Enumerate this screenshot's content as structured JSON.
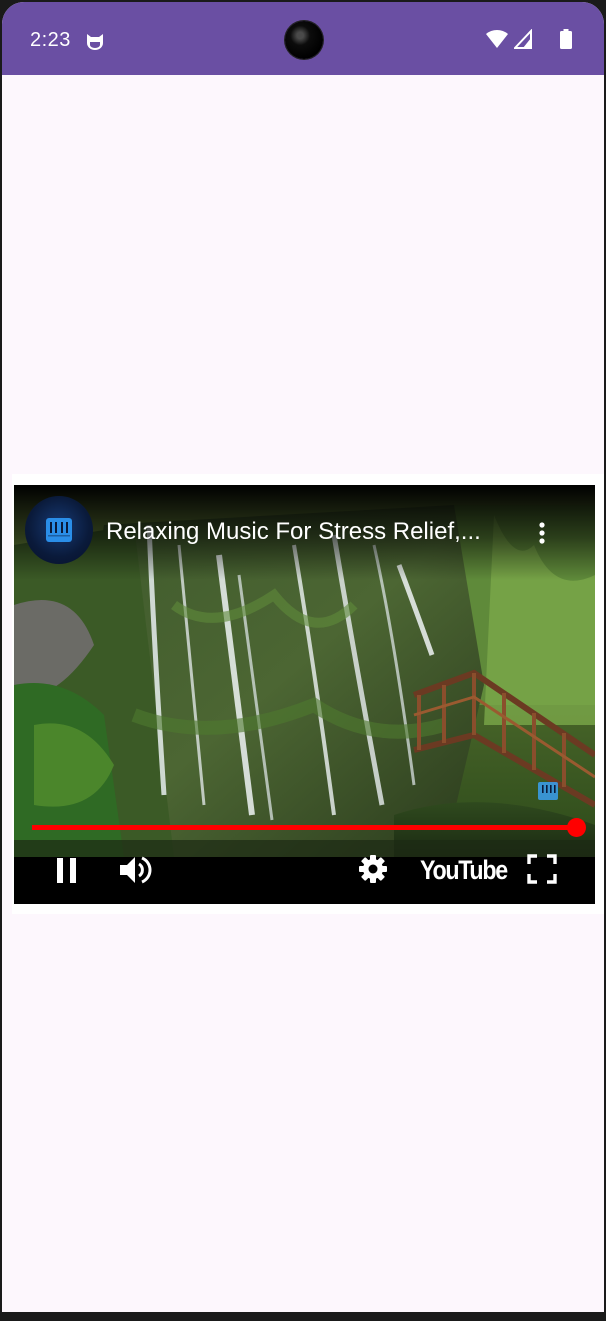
{
  "status_bar": {
    "time": "2:23",
    "background": "#6a4fa3",
    "icons": [
      "cat-notification-icon",
      "wifi-icon",
      "signal-icon",
      "battery-icon"
    ]
  },
  "player": {
    "channel_icon": "piano-icon",
    "title": "Relaxing Music For Stress Relief,...",
    "progress_fraction": 1.0,
    "progress_color": "#ff0000",
    "brand": "YouTube",
    "controls": [
      "pause-icon",
      "volume-icon",
      "settings-icon",
      "youtube-logo",
      "fullscreen-icon"
    ]
  },
  "colors": {
    "page_background": "#fdf7fd",
    "player_card": "#ffffff"
  }
}
